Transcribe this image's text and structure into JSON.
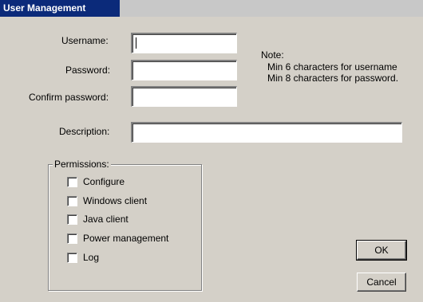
{
  "window": {
    "title": "User Management"
  },
  "form": {
    "username_label": "Username:",
    "password_label": "Password:",
    "confirm_label": "Confirm password:",
    "description_label": "Description:",
    "username_value": "",
    "password_value": "",
    "confirm_value": "",
    "description_value": ""
  },
  "note": {
    "title": "Note:",
    "line1": "Min 6 characters for username",
    "line2": "Min 8 characters for password."
  },
  "permissions": {
    "title": "Permissions:",
    "items": [
      {
        "label": "Configure",
        "checked": false
      },
      {
        "label": "Windows client",
        "checked": false
      },
      {
        "label": "Java client",
        "checked": false
      },
      {
        "label": "Power management",
        "checked": false
      },
      {
        "label": "Log",
        "checked": false
      }
    ]
  },
  "buttons": {
    "ok": "OK",
    "cancel": "Cancel"
  }
}
